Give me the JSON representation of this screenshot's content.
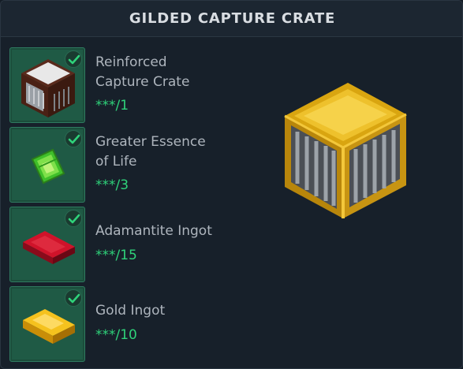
{
  "header": {
    "title": "GILDED CAPTURE CRATE"
  },
  "ingredients": [
    {
      "name_line1": "Reinforced",
      "name_line2": "Capture Crate",
      "count": "***/1",
      "icon": "reinforced-capture-crate-icon",
      "complete": true
    },
    {
      "name_line1": "Greater Essence",
      "name_line2": "of Life",
      "count": "***/3",
      "icon": "greater-essence-of-life-icon",
      "complete": true
    },
    {
      "name_line1": "Adamantite Ingot",
      "name_line2": "",
      "count": "***/15",
      "icon": "adamantite-ingot-icon",
      "complete": true
    },
    {
      "name_line1": "Gold Ingot",
      "name_line2": "",
      "count": "***/10",
      "icon": "gold-ingot-icon",
      "complete": true
    }
  ],
  "result": {
    "icon": "gilded-capture-crate-icon"
  },
  "colors": {
    "accent_green": "#2fd27a",
    "slot_green": "#1f5a45",
    "background": "#17202a"
  }
}
